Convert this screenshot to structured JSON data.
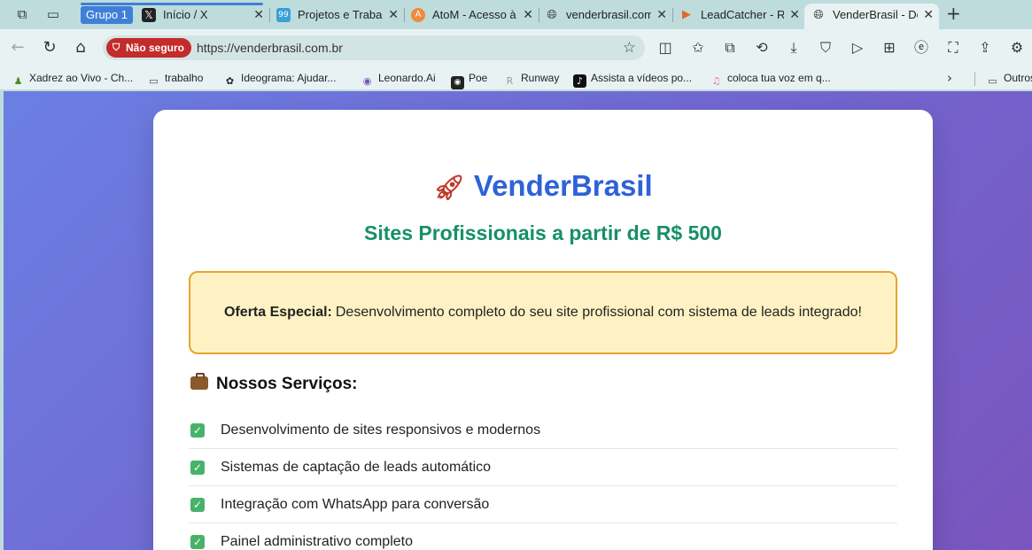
{
  "tabstrip": {
    "group_label": "Grupo 1",
    "tabs": [
      {
        "title": "Início / X",
        "favicon": "x-logo-icon"
      },
      {
        "title": "Projetos e Trabalhos",
        "favicon": "99-logo-icon"
      },
      {
        "title": "AtoM - Acesso à Memória",
        "favicon": "atom-logo-icon"
      },
      {
        "title": "venderbrasil.com.br",
        "favicon": "globe-icon"
      },
      {
        "title": "LeadCatcher - Recrutamento",
        "favicon": "leadcatcher-icon"
      },
      {
        "title": "VenderBrasil - Desenvolvimento",
        "favicon": "globe-icon",
        "active": true
      }
    ]
  },
  "toolbar": {
    "security_label": "Não seguro",
    "url": "https://venderbrasil.com.br"
  },
  "bookmarks": [
    {
      "label": "Xadrez ao Vivo - Ch...",
      "icon": "chess-pawn-icon"
    },
    {
      "label": "trabalho",
      "icon": "folder-icon"
    },
    {
      "label": "Ideograma: Ajudar...",
      "icon": "ideogram-icon"
    },
    {
      "label": "Leonardo.Ai",
      "icon": "leonardo-icon"
    },
    {
      "label": "Poe",
      "icon": "poe-icon"
    },
    {
      "label": "Runway",
      "icon": "runway-icon"
    },
    {
      "label": "Assista a vídeos po...",
      "icon": "tiktok-icon"
    },
    {
      "label": "coloca tua voz em q...",
      "icon": "music-note-icon"
    },
    {
      "label": "Outros",
      "icon": "folder-icon"
    }
  ],
  "page": {
    "brand": "VenderBrasil",
    "tagline": "Sites Profissionais a partir de R$ 500",
    "offer_label": "Oferta Especial:",
    "offer_text": "Desenvolvimento completo do seu site profissional com sistema de leads integrado!",
    "services_title": "Nossos Serviços:",
    "services": [
      "Desenvolvimento de sites responsivos e modernos",
      "Sistemas de captação de leads automático",
      "Integração com WhatsApp para conversão",
      "Painel administrativo completo"
    ]
  },
  "colors": {
    "brand_blue": "#2f62d8",
    "tagline_green": "#179066",
    "offer_bg": "#fef2c4",
    "offer_border": "#e8a42d",
    "insecure_red": "#c42b2b",
    "tab_group_blue": "#3f7fd8"
  }
}
